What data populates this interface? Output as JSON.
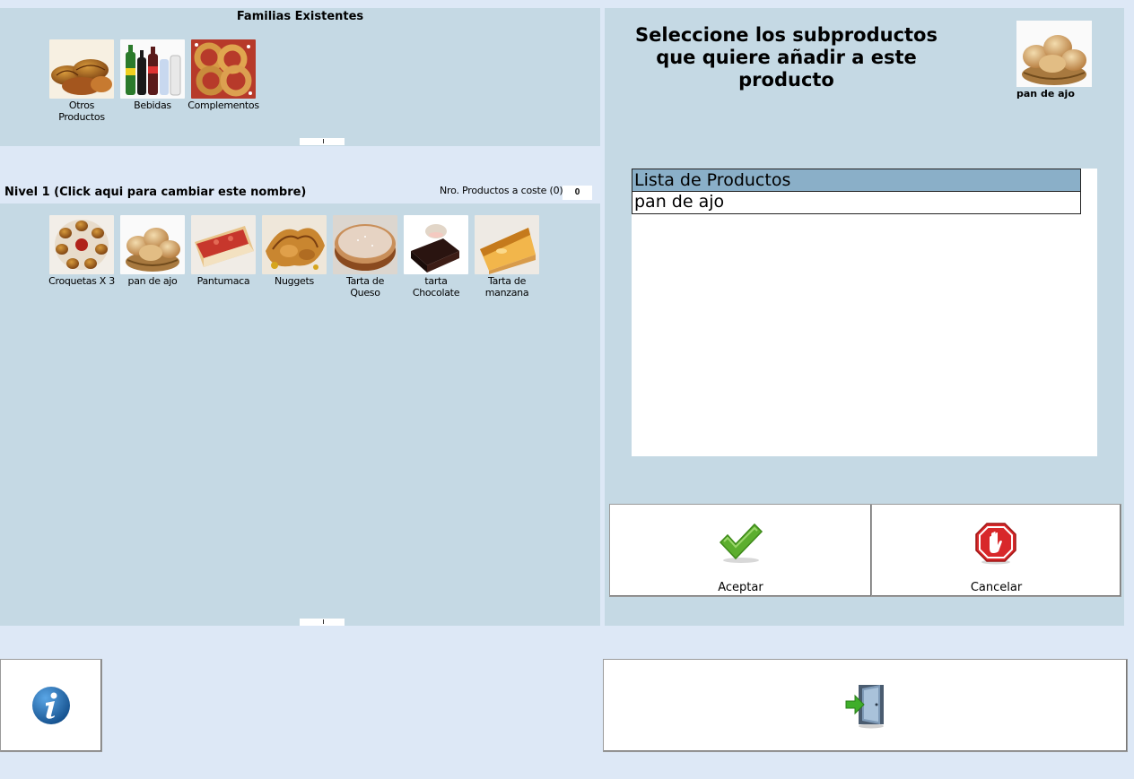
{
  "families": {
    "title": "Familias Existentes",
    "items": [
      {
        "label": "Otros\nProductos",
        "icon": "croissants-photo"
      },
      {
        "label": "Bebidas",
        "icon": "drinks-bottles-photo"
      },
      {
        "label": "Complementos",
        "icon": "onion-rings-photo"
      }
    ]
  },
  "level": {
    "name": "Nivel 1 (Click aqui para cambiar este nombre)",
    "cost_label": "Nro. Productos a coste (0)",
    "cost_value": "0"
  },
  "products": {
    "items": [
      {
        "label": "Croquetas X 3",
        "icon": "croquettes-photo"
      },
      {
        "label": "pan de ajo",
        "icon": "bread-basket-photo"
      },
      {
        "label": "Pantumaca",
        "icon": "tomato-bread-photo"
      },
      {
        "label": "Nuggets",
        "icon": "nuggets-photo"
      },
      {
        "label": "Tarta de\nQueso",
        "icon": "cheesecake-photo"
      },
      {
        "label": "tarta Chocolate",
        "icon": "chocolate-cake-photo"
      },
      {
        "label": "Tarta de\nmanzana",
        "icon": "apple-tart-photo"
      }
    ]
  },
  "right": {
    "title": "Seleccione los subproductos que quiere añadir a este producto",
    "selected_label": "pan de ajo",
    "list_header": "Lista de Productos",
    "list_rows": [
      "pan de ajo"
    ]
  },
  "buttons": {
    "accept": "Aceptar",
    "cancel": "Cancelar",
    "info_icon": "info-icon",
    "exit_icon": "exit-door-icon"
  },
  "colors": {
    "background": "#dde8f6",
    "panel": "#c5d9e4",
    "list_header": "#8aafc8",
    "accept_green": "#5cae2e",
    "cancel_red": "#d8282a",
    "info_blue": "#1b6fb5"
  }
}
